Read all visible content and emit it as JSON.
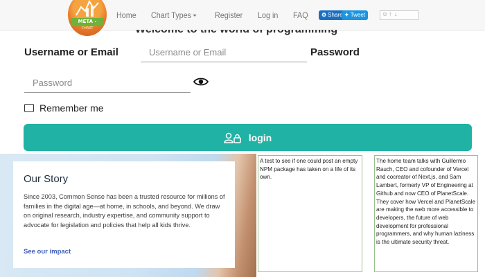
{
  "nav": {
    "logo_text": "META -",
    "logo_subtext": "CHART",
    "links": [
      "Home",
      "Chart Types",
      "Register",
      "Log in",
      "FAQ"
    ],
    "share_label": "Share",
    "tweet_label": "Tweet"
  },
  "form": {
    "welcome": "Welcome to the world of programming",
    "username_label": "Username or Email",
    "username_placeholder": "Username or Email",
    "password_label": "Password",
    "password_placeholder": "Password",
    "remember_label": "Remember me",
    "login_label": "login"
  },
  "story": {
    "title": "Our Story",
    "body": "Since 2003, Common Sense has been a trusted resource for millions of families in the digital age—at home, in schools, and beyond. We draw on original research, industry expertise, and community support to advocate for legislation and policies that help all kids thrive.",
    "link": "See our impact"
  },
  "news": [
    "A test to see if one could post an empty NPM package has taken on a life of its own.",
    "The home team talks with Guillermo Rauch, CEO and cofounder of Vercel and cocreator of Next.js, and Sam Lambert, formerly VP of Engineering at Github and now CEO of PlanetScale. They cover how Vercel and PlanetScale are making the web more accessible to developers, the future of web development for professional programmers, and why human laziness is the ultimate security threat."
  ],
  "colors": {
    "accent": "#20b2a4",
    "link": "#3b5bb8",
    "news_border": "#9ac08a"
  }
}
